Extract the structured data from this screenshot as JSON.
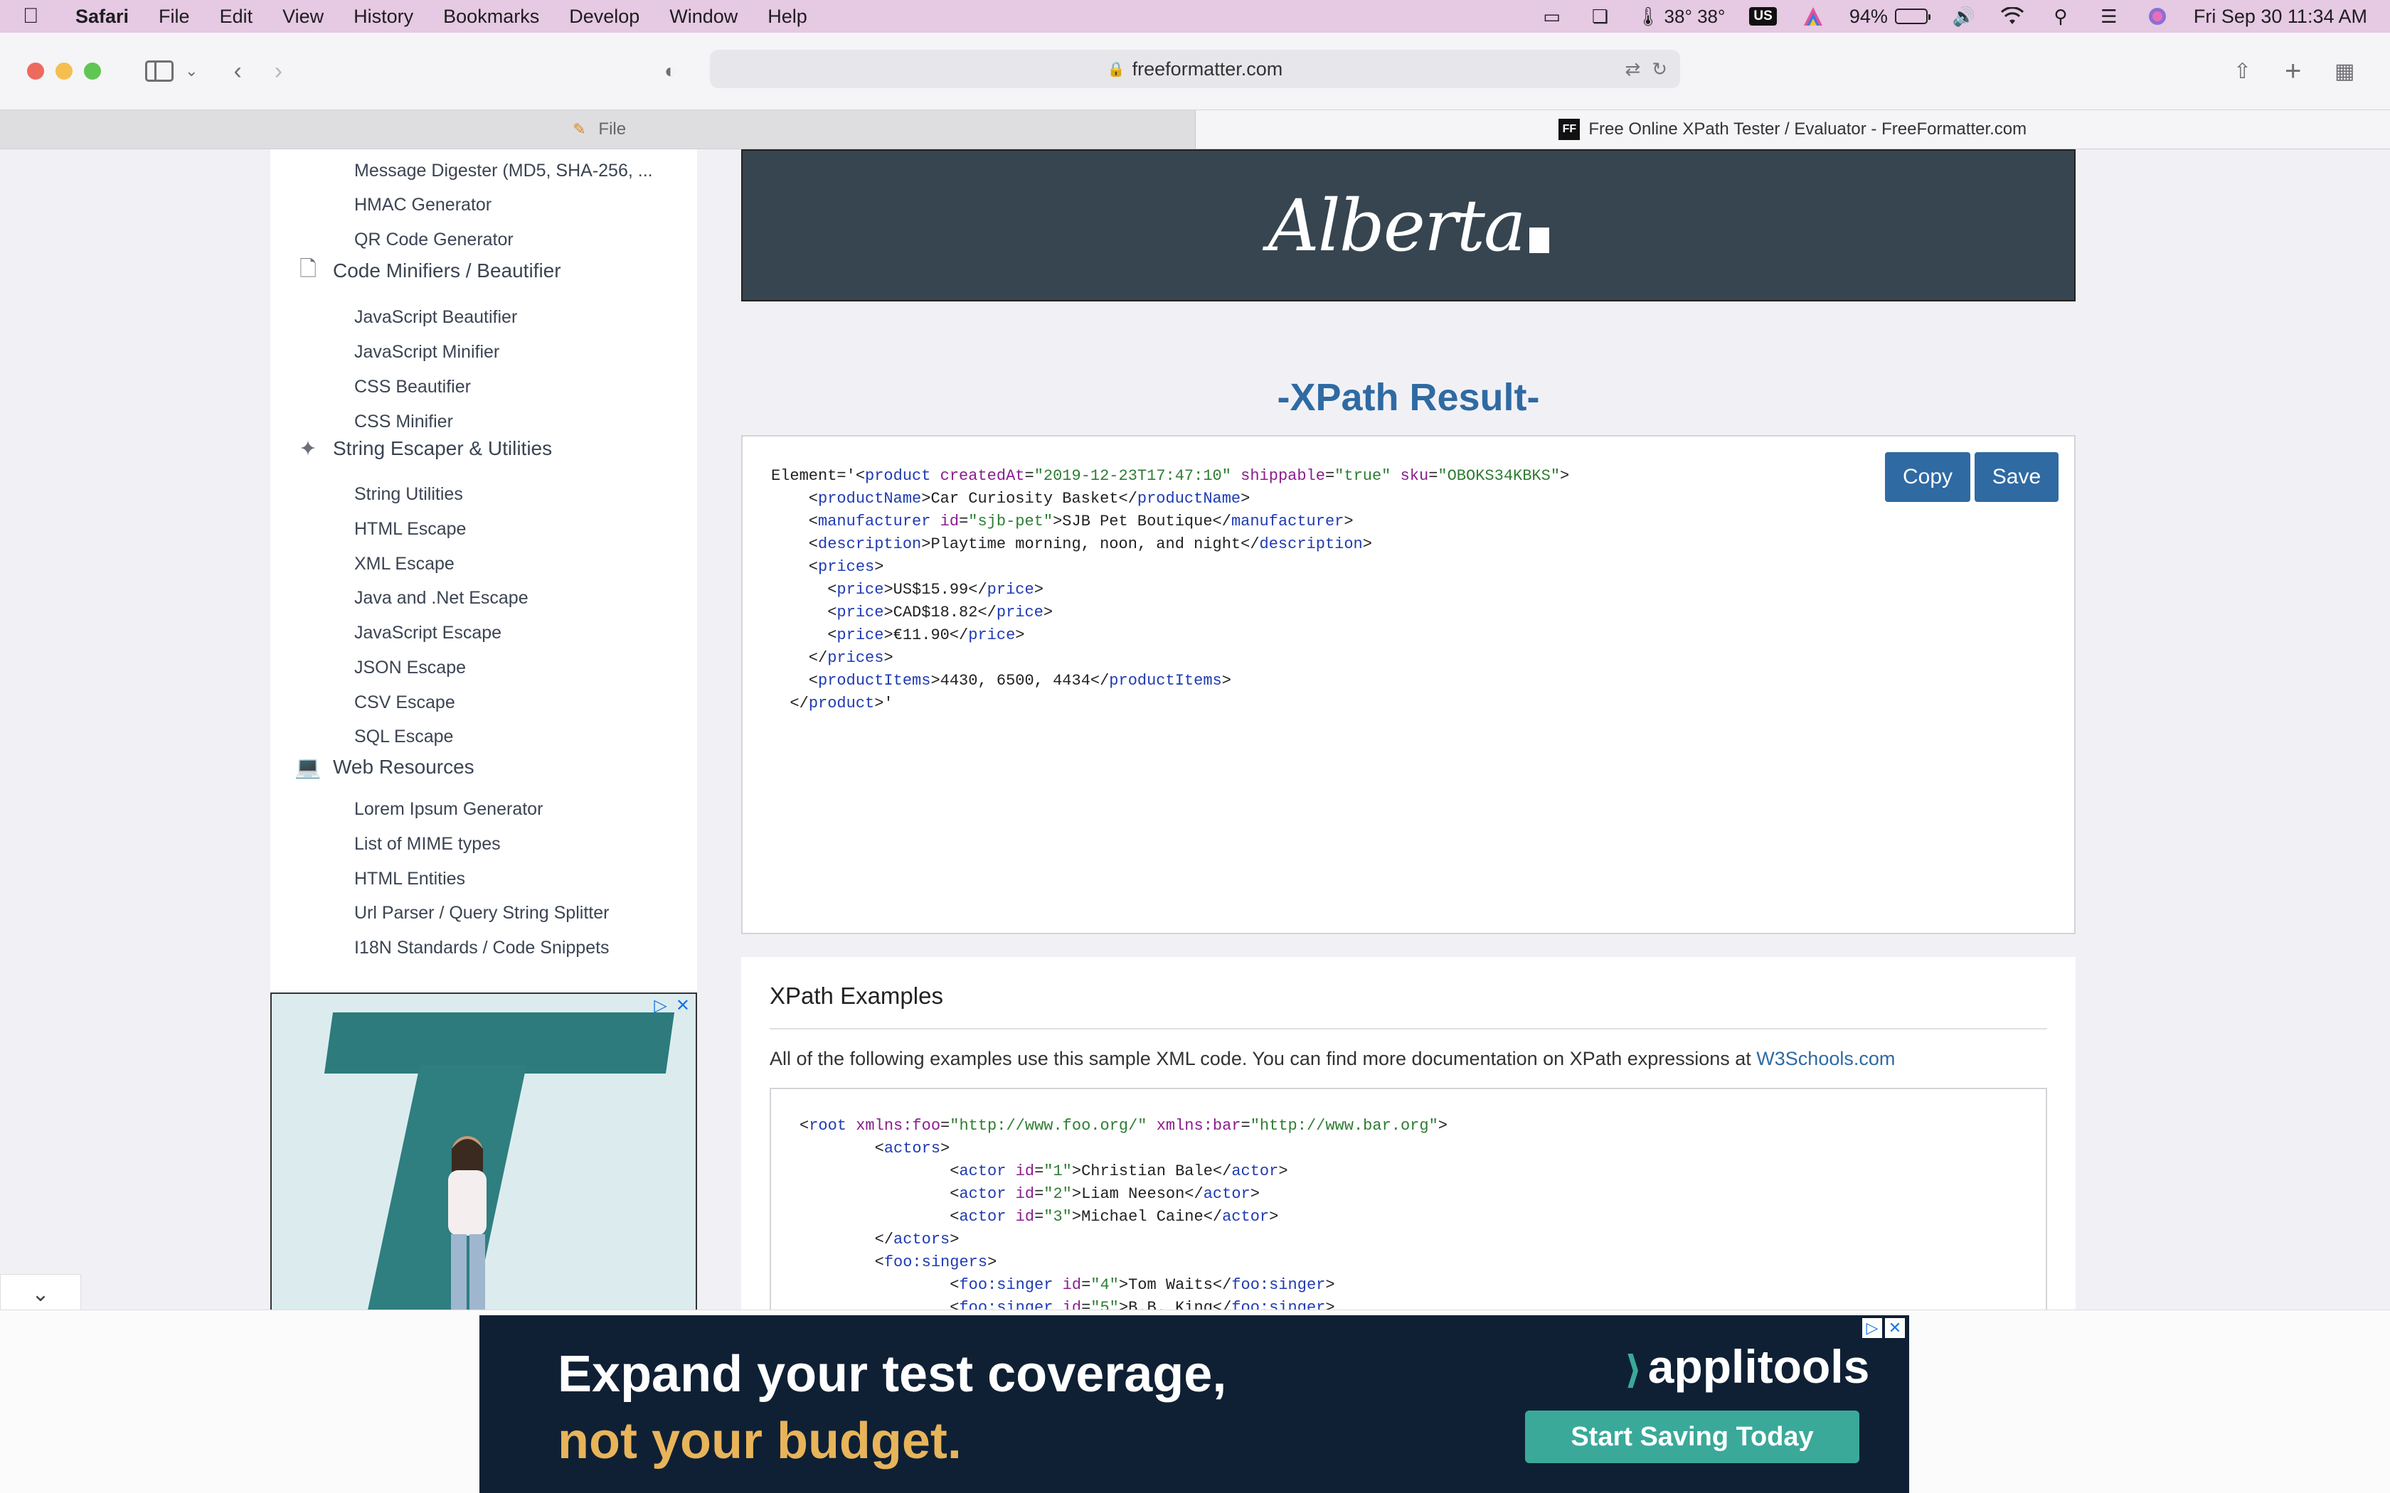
{
  "menubar": {
    "app": "Safari",
    "items": [
      "File",
      "Edit",
      "View",
      "History",
      "Bookmarks",
      "Develop",
      "Window",
      "Help"
    ],
    "weather": "38° 38°",
    "input_source": "US",
    "battery": "94%",
    "battery_level": 0.94,
    "datetime": "Fri Sep 30  11:34 AM"
  },
  "toolbar": {
    "url": "freeformatter.com"
  },
  "tabs": {
    "inactive_label": "File",
    "active_label": "Free Online XPath Tester / Evaluator - FreeFormatter.com",
    "active_icon_text": "FF"
  },
  "sidebar": {
    "items_top": [
      "Message Digester (MD5, SHA-256, ...",
      "HMAC Generator",
      "QR Code Generator"
    ],
    "cat_minifiers": "Code Minifiers / Beautifier",
    "items_minifiers": [
      "JavaScript Beautifier",
      "JavaScript Minifier",
      "CSS Beautifier",
      "CSS Minifier"
    ],
    "cat_escaper": "String Escaper & Utilities",
    "items_escaper": [
      "String Utilities",
      "HTML Escape",
      "XML Escape",
      "Java and .Net Escape",
      "JavaScript Escape",
      "JSON Escape",
      "CSV Escape",
      "SQL Escape"
    ],
    "cat_web": "Web Resources",
    "items_web": [
      "Lorem Ipsum Generator",
      "List of MIME types",
      "HTML Entities",
      "Url Parser / Query String Splitter",
      "I18N Standards / Code Snippets"
    ]
  },
  "banner": {
    "logo_text": "Alberta"
  },
  "result": {
    "title": "-XPath Result-",
    "copy_label": "Copy",
    "save_label": "Save"
  },
  "examples": {
    "heading": "XPath Examples",
    "intro": "All of the following examples use this sample XML code. You can find more documentation on XPath expressions at ",
    "link": "W3Schools.com"
  },
  "ad_bottom": {
    "headline_1": "Expand your test coverage,",
    "headline_2": "not your budget.",
    "brand": "applitools",
    "cta": "Start Saving Today"
  },
  "colors": {
    "accent": "#2f6aa3",
    "banner_bg": "#36454f",
    "menubar_bg": "#e6c9e2",
    "ad_cta": "#3aa999"
  }
}
